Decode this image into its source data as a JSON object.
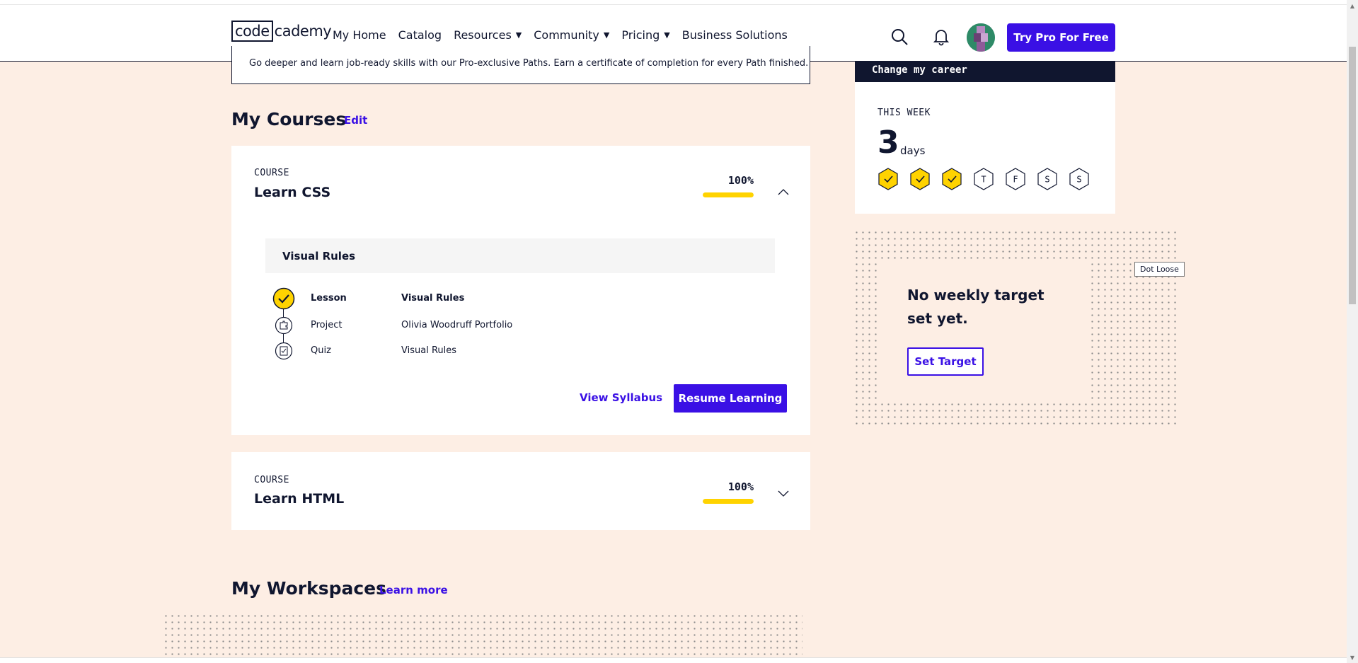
{
  "header": {
    "logo_boxed": "code",
    "logo_rest": "cademy",
    "nav": [
      {
        "label": "My Home",
        "caret": false
      },
      {
        "label": "Catalog",
        "caret": false
      },
      {
        "label": "Resources",
        "caret": true
      },
      {
        "label": "Community",
        "caret": true
      },
      {
        "label": "Pricing",
        "caret": true
      },
      {
        "label": "Business Solutions",
        "caret": false
      }
    ],
    "caret_glyph": "▼",
    "cta": "Try Pro For Free"
  },
  "banner": {
    "text": "Go deeper and learn job-ready skills with our Pro-exclusive Paths. Earn a certificate of completion for every Path finished."
  },
  "my_courses": {
    "title": "My Courses",
    "edit_label": "Edit",
    "courses": [
      {
        "kicker": "COURSE",
        "title": "Learn CSS",
        "percent_label": "100%",
        "progress": 1.0,
        "expanded": true,
        "module": "Visual Rules",
        "items": [
          {
            "type": "Lesson",
            "name": "Visual Rules",
            "current": true
          },
          {
            "type": "Project",
            "name": "Olivia Woodruff Portfolio",
            "current": false
          },
          {
            "type": "Quiz",
            "name": "Visual Rules",
            "current": false
          }
        ],
        "syllabus_label": "View Syllabus",
        "resume_label": "Resume Learning"
      },
      {
        "kicker": "COURSE",
        "title": "Learn HTML",
        "percent_label": "100%",
        "progress": 1.0,
        "expanded": false
      }
    ]
  },
  "my_workspaces": {
    "title": "My Workspaces",
    "link_label": "Learn more"
  },
  "goal": {
    "label": "Change my career"
  },
  "this_week": {
    "label": "THIS WEEK",
    "count": "3",
    "unit": "days",
    "days": [
      {
        "letter": "",
        "done": true
      },
      {
        "letter": "",
        "done": true
      },
      {
        "letter": "",
        "done": true
      },
      {
        "letter": "T",
        "done": false
      },
      {
        "letter": "F",
        "done": false
      },
      {
        "letter": "S",
        "done": false
      },
      {
        "letter": "S",
        "done": false
      }
    ]
  },
  "weekly_target": {
    "title": "No weekly target set yet.",
    "button": "Set Target"
  },
  "tooltip": "Dot Loose",
  "colors": {
    "accent": "#3a10e5",
    "navy": "#10162f",
    "yellow": "#ffd300",
    "page_bg": "#fdeee4"
  }
}
